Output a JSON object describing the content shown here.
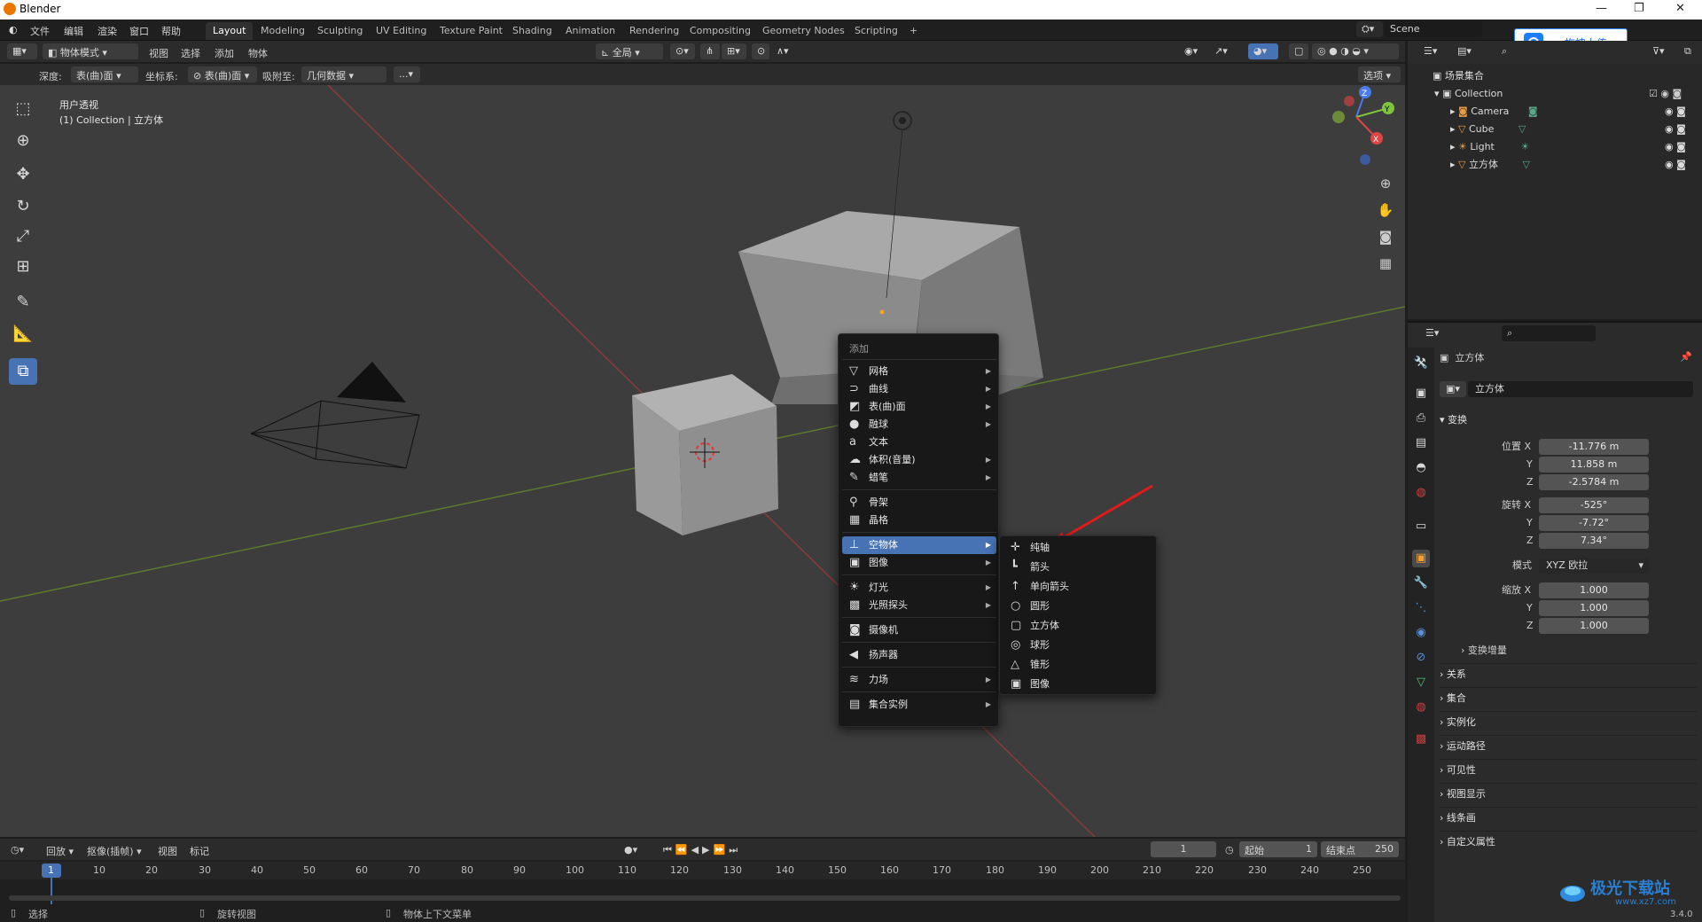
{
  "app": {
    "title": "Blender"
  },
  "menu": [
    "文件",
    "编辑",
    "渲染",
    "窗口",
    "帮助"
  ],
  "workspaces": [
    "Layout",
    "Modeling",
    "Sculpting",
    "UV Editing",
    "Texture Paint",
    "Shading",
    "Animation",
    "Rendering",
    "Compositing",
    "Geometry Nodes",
    "Scripting",
    "+"
  ],
  "scene": "Scene",
  "upload_btn": "拖拽上传",
  "header": {
    "mode": "物体模式",
    "view": "视图",
    "select": "选择",
    "add": "添加",
    "object": "物体",
    "orient": "全局",
    "options": "选项"
  },
  "toolsettings": {
    "depth_label": "深度:",
    "depth_val": "表(曲)面",
    "coord_label": "坐标系:",
    "coord_val": "表(曲)面",
    "snap_label": "吸附至:",
    "snap_val": "几何数据",
    "more": "..."
  },
  "viewport": {
    "line1": "用户透视",
    "line2": "(1) Collection | 立方体"
  },
  "addmenu": {
    "title": "添加",
    "items": [
      {
        "label": "网格",
        "icon": "▽",
        "sub": true
      },
      {
        "label": "曲线",
        "icon": "⊃",
        "sub": true
      },
      {
        "label": "表(曲)面",
        "icon": "◩",
        "sub": true
      },
      {
        "label": "融球",
        "icon": "●",
        "sub": true
      },
      {
        "label": "文本",
        "icon": "a",
        "sub": false
      },
      {
        "label": "体积(音量)",
        "icon": "☁",
        "sub": true
      },
      {
        "label": "蜡笔",
        "icon": "✎",
        "sub": true
      },
      {
        "label": "骨架",
        "icon": "⚲",
        "sub": false
      },
      {
        "label": "晶格",
        "icon": "▦",
        "sub": false
      },
      {
        "label": "空物体",
        "icon": "⊥",
        "sub": true
      },
      {
        "label": "图像",
        "icon": "▣",
        "sub": true
      },
      {
        "label": "灯光",
        "icon": "☀",
        "sub": true
      },
      {
        "label": "光照探头",
        "icon": "▩",
        "sub": true
      },
      {
        "label": "摄像机",
        "icon": "◙",
        "sub": false
      },
      {
        "label": "扬声器",
        "icon": "◀",
        "sub": false
      },
      {
        "label": "力场",
        "icon": "≋",
        "sub": true
      },
      {
        "label": "集合实例",
        "icon": "▤",
        "sub": true
      }
    ]
  },
  "submenu": [
    {
      "label": "纯轴",
      "icon": "✛"
    },
    {
      "label": "箭头",
      "icon": "┗"
    },
    {
      "label": "单向箭头",
      "icon": "↑"
    },
    {
      "label": "圆形",
      "icon": "○"
    },
    {
      "label": "立方体",
      "icon": "▢"
    },
    {
      "label": "球形",
      "icon": "◎"
    },
    {
      "label": "锥形",
      "icon": "△"
    },
    {
      "label": "图像",
      "icon": "▣"
    }
  ],
  "timeline": {
    "playback": "回放",
    "keying": "抠像(插帧)",
    "view": "视图",
    "marker": "标记",
    "frame": "1",
    "start_label": "起始",
    "start": "1",
    "end_label": "结束点",
    "end": "250",
    "ticks": [
      "1",
      "10",
      "20",
      "30",
      "40",
      "50",
      "60",
      "70",
      "80",
      "90",
      "100",
      "110",
      "120",
      "130",
      "140",
      "150",
      "160",
      "170",
      "180",
      "190",
      "200",
      "210",
      "220",
      "230",
      "240",
      "250"
    ]
  },
  "status": {
    "select": "选择",
    "rotate": "旋转视图",
    "context": "物体上下文菜单",
    "version": "3.4.0"
  },
  "outliner": {
    "root": "场景集合",
    "collection": "Collection",
    "items": [
      "Camera",
      "Cube",
      "Light",
      "立方体"
    ]
  },
  "props": {
    "object_name": "立方体",
    "data_name": "立方体",
    "transform": "变换",
    "location": {
      "label": "位置 X",
      "x": "-11.776 m",
      "y": "11.858 m",
      "z": "-2.5784 m"
    },
    "rotation": {
      "label": "旋转 X",
      "x": "-525°",
      "y": "-7.72°",
      "z": "7.34°"
    },
    "mode_label": "模式",
    "mode_val": "XYZ 欧拉",
    "scale": {
      "label": "缩放 X",
      "x": "1.000",
      "y": "1.000",
      "z": "1.000"
    },
    "axis_y": "Y",
    "axis_z": "Z",
    "delta": "变换增量",
    "sections": [
      "关系",
      "集合",
      "实例化",
      "运动路径",
      "可见性",
      "视图显示",
      "线条画",
      "自定义属性"
    ]
  },
  "watermark": {
    "line1": "极光下载站",
    "line2": "www.xz7.com"
  },
  "colors": {
    "accent": "#4772b3",
    "red_arrow": "#e01b1b",
    "viewport": "#3d3d3d"
  }
}
